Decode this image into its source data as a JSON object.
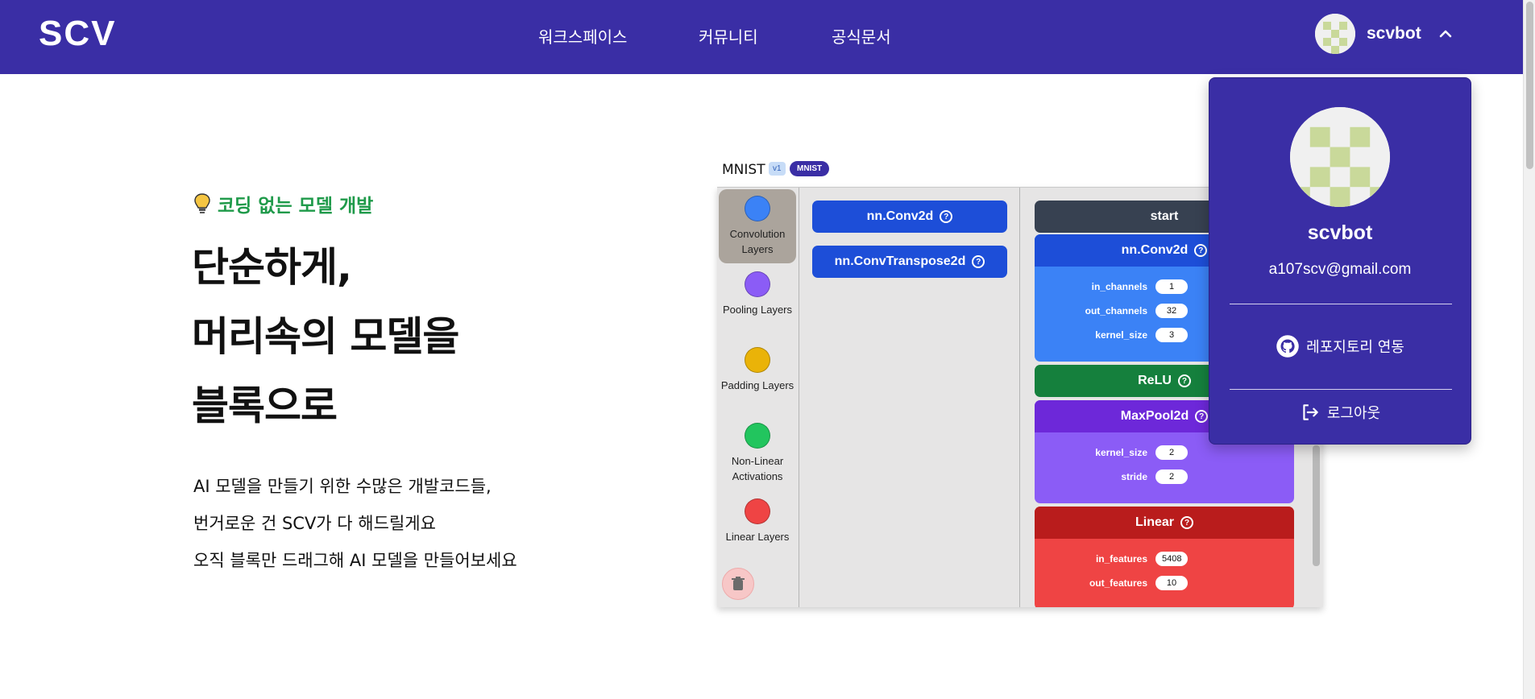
{
  "header": {
    "logo_text": "SCV",
    "nav": [
      "워크스페이스",
      "커뮤니티",
      "공식문서"
    ],
    "user_name": "scvbot"
  },
  "hero": {
    "tagline": "코딩 없는 모델 개발",
    "title_lines": [
      "단순하게,",
      "머리속의 모델을",
      "블록으로"
    ],
    "description_lines": [
      "AI 모델을 만들기 위한 수많은 개발코드들,",
      "번거로운 건 SCV가 다 해드릴게요",
      "오직 블록만 드래그해 AI 모델을 만들어보세요"
    ]
  },
  "editor": {
    "title": "MNIST",
    "version_badge": "v1",
    "dataset_badge": "MNIST",
    "categories": [
      {
        "label": "Convolution Layers",
        "color": "#3b82f6"
      },
      {
        "label": "Pooling Layers",
        "color": "#8b5cf6"
      },
      {
        "label": "Padding Layers",
        "color": "#eab308"
      },
      {
        "label": "Non-Linear Activations",
        "color": "#22c55e"
      },
      {
        "label": "Linear Layers",
        "color": "#ef4444"
      }
    ],
    "palette_blocks": [
      "nn.Conv2d",
      "nn.ConvTranspose2d"
    ],
    "canvas": {
      "start": "start",
      "conv": {
        "title": "nn.Conv2d",
        "params": [
          {
            "k": "in_channels",
            "v": "1"
          },
          {
            "k": "out_channels",
            "v": "32"
          },
          {
            "k": "kernel_size",
            "v": "3"
          }
        ]
      },
      "relu": {
        "title": "ReLU"
      },
      "maxpool": {
        "title": "MaxPool2d",
        "params": [
          {
            "k": "kernel_size",
            "v": "2"
          },
          {
            "k": "stride",
            "v": "2"
          }
        ]
      },
      "linear": {
        "title": "Linear",
        "params": [
          {
            "k": "in_features",
            "v": "5408"
          },
          {
            "k": "out_features",
            "v": "10"
          }
        ]
      }
    },
    "help_glyph": "?"
  },
  "dropdown": {
    "name": "scvbot",
    "email": "a107scv@gmail.com",
    "repo_link": "레포지토리 연동",
    "logout": "로그아웃"
  },
  "colors": {
    "brand": "#3a2ea5",
    "tagline_green": "#1f9a4a"
  }
}
